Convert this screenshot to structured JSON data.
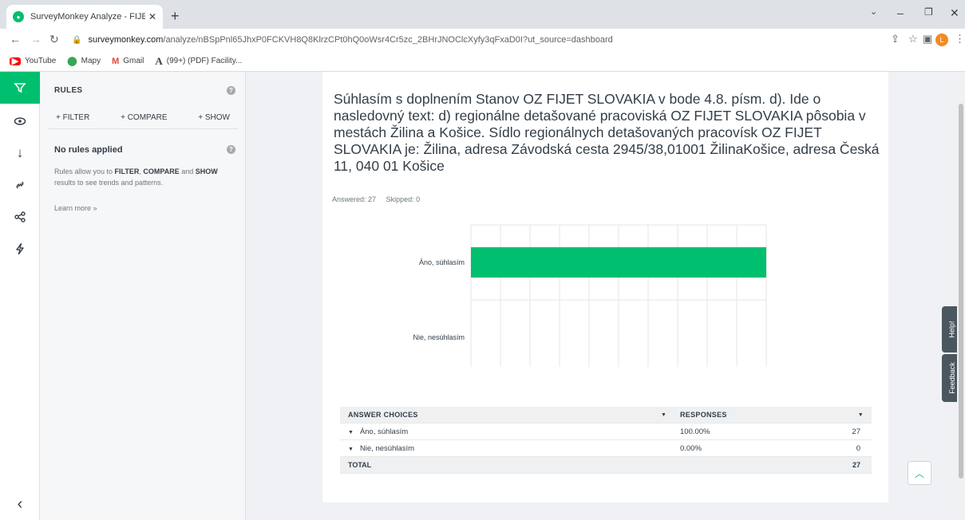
{
  "browser": {
    "tab_title": "SurveyMonkey Analyze - FIJET hl",
    "tab_close": "✕",
    "new_tab": "+",
    "url_host": "surveymonkey.com",
    "url_path": "/analyze/nBSpPnl65JhxP0FCKVH8Q8KlrzCPt0hQ0oWsr4Cr5zc_2BHrJNOClcXyfy3qFxaD0I?ut_source=dashboard",
    "profile_initial": "L",
    "bookmarks": [
      {
        "label": "YouTube",
        "icon": "youtube-icon"
      },
      {
        "label": "Mapy",
        "icon": "maps-pin-icon"
      },
      {
        "label": "Gmail",
        "icon": "gmail-icon"
      },
      {
        "label": "(99+) (PDF) Facility...",
        "icon": "academia-icon"
      }
    ]
  },
  "rules_panel": {
    "title": "RULES",
    "filter": "+ FILTER",
    "compare": "+ COMPARE",
    "show": "+ SHOW",
    "no_rules": "No rules applied",
    "desc_1": "Rules allow you to ",
    "desc_filter": "FILTER",
    "desc_sep1": ", ",
    "desc_compare": "COMPARE",
    "desc_and": " and ",
    "desc_show": "SHOW",
    "desc_2": " results to see trends and patterns.",
    "learn_more": "Learn more »"
  },
  "question": {
    "text": "Súhlasím s  doplnením Stanov OZ FIJET SLOVAKIA v bode 4.8.  písm.  d). Ide o  nasledovný text:  d) regionálne detašované pracoviská  OZ FIJET SLOVAKIA pôsobia v mestách  Žilina a Košice. Sídlo regionálnych detašovaných pracovísk OZ FIJET SLOVAKIA je: Žilina, adresa Závodská cesta 2945/38,01001 ŽilinaKošice, adresa Česká 11, 040 01 Košice",
    "answered": "Answered: 27",
    "skipped": "Skipped: 0"
  },
  "chart_data": {
    "type": "bar",
    "orientation": "horizontal",
    "categories": [
      "Áno, súhlasím",
      "Nie, nesúhlasím"
    ],
    "values": [
      100,
      0
    ],
    "xlim": [
      0,
      100
    ],
    "ticks": [
      "0%",
      "10%",
      "20%",
      "30%",
      "40%",
      "50%",
      "60%",
      "70%",
      "80%",
      "90%",
      "100%"
    ],
    "bar_color": "#00bf6f",
    "grid": true
  },
  "table": {
    "header_choices": "ANSWER CHOICES",
    "header_responses": "RESPONSES",
    "rows": [
      {
        "choice": "Áno, súhlasím",
        "percent": "100.00%",
        "count": "27"
      },
      {
        "choice": "Nie, nesúhlasím",
        "percent": "0.00%",
        "count": "0"
      }
    ],
    "total_label": "TOTAL",
    "total_count": "27"
  },
  "widgets": {
    "help": "Help!",
    "feedback": "Feedback"
  },
  "colors": {
    "accent": "#00bf6f",
    "dark": "#333e48"
  }
}
